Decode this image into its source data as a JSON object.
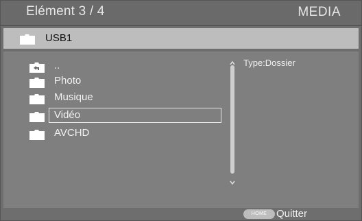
{
  "header": {
    "title": "Elément 3 / 4",
    "mode": "MEDIA"
  },
  "path": {
    "label": "USB1",
    "icon": "folder-icon"
  },
  "list": {
    "items": [
      {
        "label": "..",
        "icon": "parent-folder-icon"
      },
      {
        "label": "Photo",
        "icon": "folder-icon"
      },
      {
        "label": "Musique",
        "icon": "folder-icon"
      },
      {
        "label": "Vidéo",
        "icon": "folder-icon",
        "selected": true
      },
      {
        "label": "AVCHD",
        "icon": "folder-icon"
      }
    ]
  },
  "info": {
    "text": "Type:Dossier"
  },
  "footer": {
    "home_label": "HOME",
    "quit_label": "Quitter"
  },
  "colors": {
    "background": "#7f7f7f",
    "header": "#6a6a6a",
    "pathbar": "#bdbdbd",
    "text": "#f2f2f2"
  }
}
